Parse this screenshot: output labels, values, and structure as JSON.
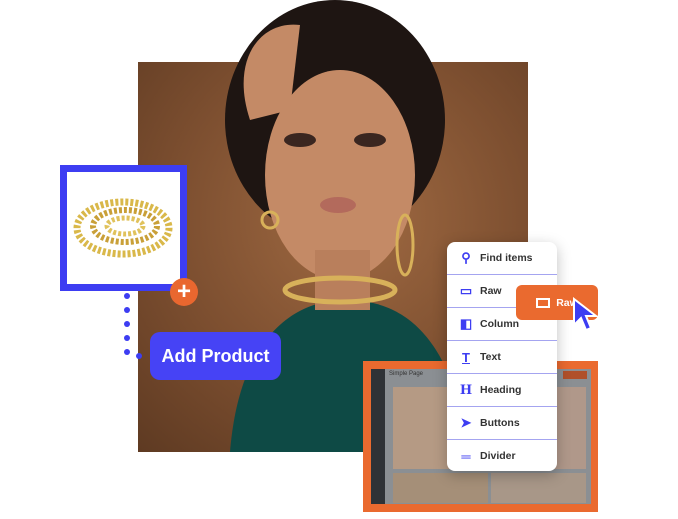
{
  "product_card": {
    "image": "gold-chain-necklace",
    "add_icon": "plus-icon"
  },
  "add_product_button": {
    "label": "Add Product"
  },
  "element_menu": {
    "items": [
      {
        "icon": "search-icon",
        "label": "Find items"
      },
      {
        "icon": "rectangle-icon",
        "label": "Raw"
      },
      {
        "icon": "column-icon",
        "label": "Column"
      },
      {
        "icon": "text-icon",
        "label": "Text"
      },
      {
        "icon": "heading-icon",
        "label": "Heading"
      },
      {
        "icon": "pointer-icon",
        "label": "Buttons"
      },
      {
        "icon": "divider-icon",
        "label": "Divider"
      }
    ]
  },
  "dragged_item": {
    "icon": "rectangle-icon",
    "label": "Raw"
  },
  "page_preview": {
    "title": "Simple Page"
  },
  "colors": {
    "accent_blue": "#3d3df2",
    "accent_orange": "#ea6a2f"
  }
}
